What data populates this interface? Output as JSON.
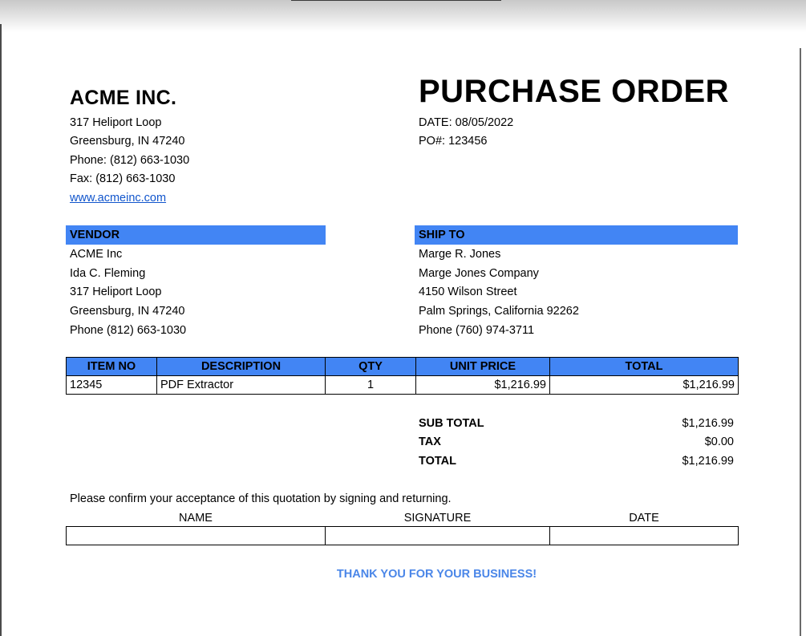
{
  "company": {
    "name": "ACME INC.",
    "address1": "317 Heliport Loop",
    "address2": "Greensburg, IN 47240",
    "phone": "Phone: (812) 663-1030",
    "fax": "Fax: (812) 663-1030",
    "website": "www.acmeinc.com"
  },
  "document": {
    "title": "PURCHASE ORDER",
    "date": "DATE: 08/05/2022",
    "po_number": "PO#: 123456"
  },
  "vendor": {
    "heading": "VENDOR",
    "lines": [
      "ACME Inc",
      "Ida C. Fleming",
      "317 Heliport Loop",
      "Greensburg, IN 47240",
      "Phone (812) 663-1030"
    ]
  },
  "ship_to": {
    "heading": "SHIP TO",
    "lines": [
      "Marge R. Jones",
      "Marge Jones Company",
      "4150 Wilson Street",
      "Palm Springs, California 92262",
      "Phone (760) 974-3711"
    ]
  },
  "items": {
    "headers": [
      "ITEM NO",
      "DESCRIPTION",
      "QTY",
      "UNIT PRICE",
      "TOTAL"
    ],
    "rows": [
      [
        "12345",
        "PDF Extractor",
        "1",
        "$1,216.99",
        "$1,216.99"
      ]
    ]
  },
  "summary": {
    "subtotal_label": "SUB TOTAL",
    "subtotal_value": "$1,216.99",
    "tax_label": "TAX",
    "tax_value": "$0.00",
    "total_label": "TOTAL",
    "total_value": "$1,216.99"
  },
  "signature": {
    "prompt": "Please confirm your acceptance of this quotation by signing and returning.",
    "headers": [
      "NAME",
      "SIGNATURE",
      "DATE"
    ],
    "values": [
      "",
      "",
      ""
    ]
  },
  "footer": {
    "thanks": "THANK YOU FOR YOUR BUSINESS!"
  },
  "colors": {
    "band_blue": "#4285f4",
    "thanks_blue": "#4a86e8",
    "link_blue": "#1155cc"
  }
}
